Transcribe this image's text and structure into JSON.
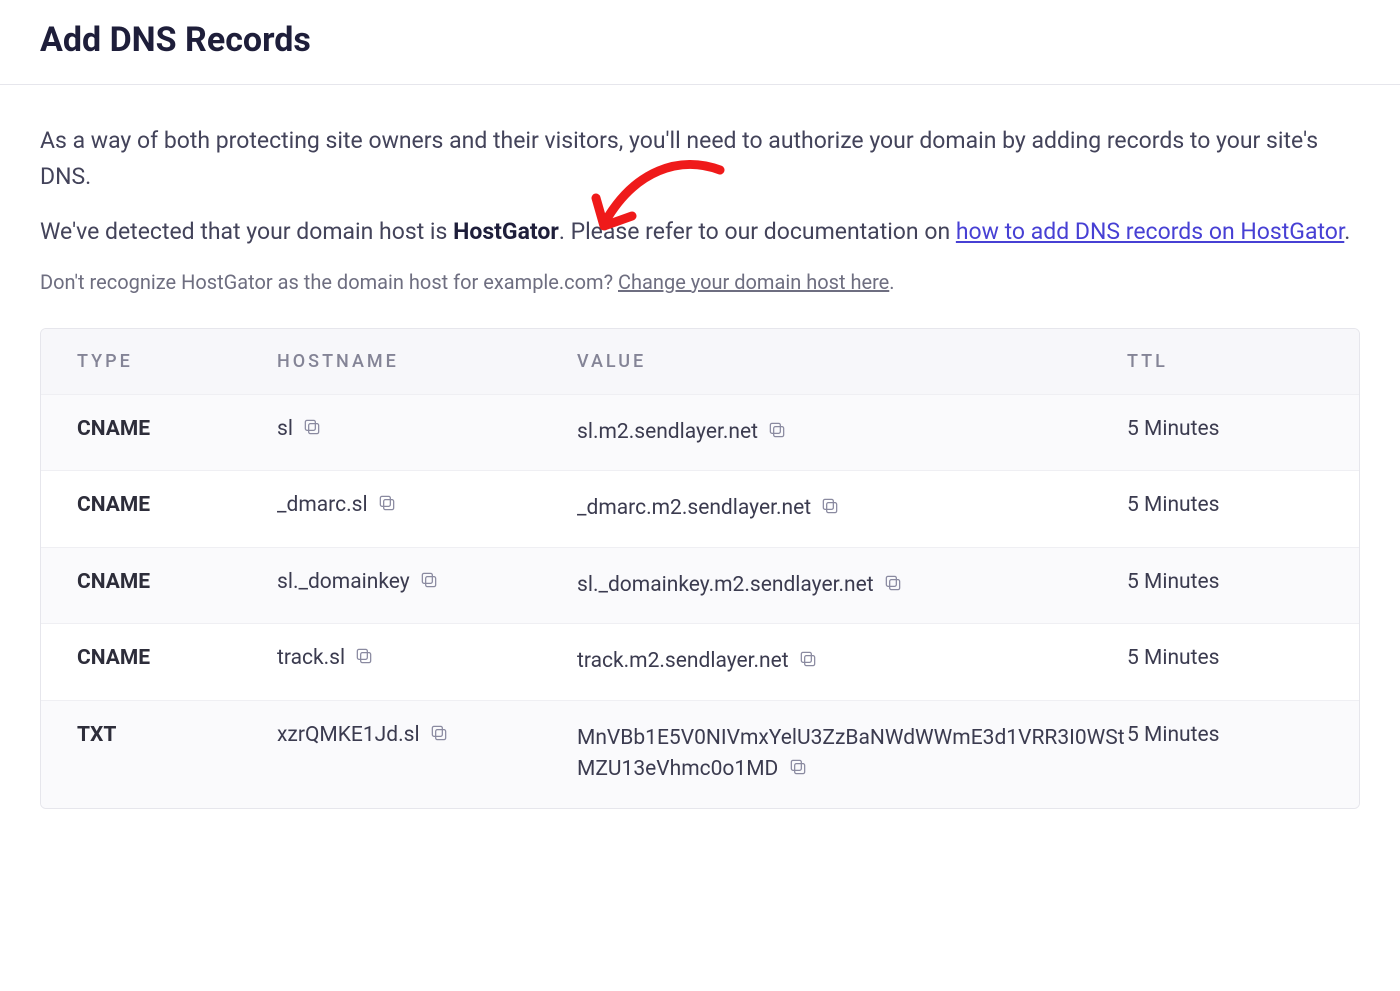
{
  "title": "Add DNS Records",
  "intro1": "As a way of both protecting site owners and their visitors, you'll need to authorize your domain by adding records to your site's DNS.",
  "intro2_pre": "We've detected that your domain host is ",
  "intro2_host": "HostGator",
  "intro2_post": ". Please refer to our documentation on ",
  "intro2_link": "how to add DNS records on HostGator",
  "subnote_pre": "Don't recognize HostGator as the domain host for example.com? ",
  "subnote_link": "Change your domain host here",
  "columns": {
    "type": "TYPE",
    "hostname": "HOSTNAME",
    "value": "VALUE",
    "ttl": "TTL"
  },
  "records": [
    {
      "type": "CNAME",
      "hostname": "sl",
      "value": "sl.m2.sendlayer.net",
      "ttl": "5 Minutes"
    },
    {
      "type": "CNAME",
      "hostname": "_dmarc.sl",
      "value": "_dmarc.m2.sendlayer.net",
      "ttl": "5 Minutes"
    },
    {
      "type": "CNAME",
      "hostname": "sl._domainkey",
      "value": "sl._domainkey.m2.sendlayer.net",
      "ttl": "5 Minutes"
    },
    {
      "type": "CNAME",
      "hostname": "track.sl",
      "value": "track.m2.sendlayer.net",
      "ttl": "5 Minutes"
    },
    {
      "type": "TXT",
      "hostname": "xzrQMKE1Jd.sl",
      "value": "MnVBb1E5V0NIVmxYelU3ZzBaNWdWWmE3d1VRR3I0WStMZU13eVhmc0o1MD",
      "ttl": "5 Minutes"
    }
  ]
}
